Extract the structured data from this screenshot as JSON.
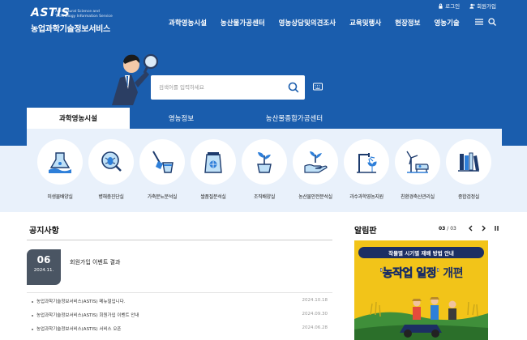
{
  "header": {
    "logo_mark": "ASTIS",
    "logo_sub_1": "Agricultural Science and",
    "logo_sub_2": "Technology Information Service",
    "logo_name": "농업과학기술정보서비스",
    "util": {
      "login": "로그인",
      "join": "회원가입"
    },
    "nav": [
      "과학영농시설",
      "농산물가공센터",
      "영농상담및의견조사",
      "교육및행사",
      "현장정보",
      "영농기술"
    ]
  },
  "search": {
    "placeholder": "검색어를 입력하세요"
  },
  "tabs": [
    {
      "label": "과학영농시설",
      "active": true
    },
    {
      "label": "영농정보",
      "active": false
    },
    {
      "label": "농산물종합가공센터",
      "active": false
    }
  ],
  "facilities": [
    {
      "label": "미생물배양실",
      "icon": "microbe-hand-icon"
    },
    {
      "label": "병해충진단실",
      "icon": "bug-magnifier-icon"
    },
    {
      "label": "가축분뇨분석실",
      "icon": "shovel-bucket-icon"
    },
    {
      "label": "쌀품질분석실",
      "icon": "rice-bag-icon"
    },
    {
      "label": "조직배양실",
      "icon": "sprout-pot-icon"
    },
    {
      "label": "농산물안전분석실",
      "icon": "plant-hand-icon"
    },
    {
      "label": "과수과학영농지원",
      "icon": "sprinkler-plant-icon"
    },
    {
      "label": "친환경축산관리실",
      "icon": "windmill-cow-icon"
    },
    {
      "label": "종합검정실",
      "icon": "book-shelf-icon"
    }
  ],
  "notice": {
    "title": "공지사항",
    "featured": {
      "day": "06",
      "ym": "2024.11.",
      "text": "회원가입 이벤트 결과"
    },
    "items": [
      {
        "text": "농업과학기술정보서비스(ASTIS) 메뉴얼입니다.",
        "date": "2024.10.18"
      },
      {
        "text": "농업과학기술정보서비스(ASTIS) 회원가입 이벤트 안내",
        "date": "2024.09.30"
      },
      {
        "text": "농업과학기술정보서비스(ASTIS) 서비스 오픈",
        "date": "2024.06.28"
      }
    ]
  },
  "alarm": {
    "title": "알림판",
    "current": "03",
    "total": "/ 03",
    "banner_head": "작물별 시기별 재배 방법 안내",
    "banner_main_hl": "'농작업 일정'",
    "banner_main_rest": " 개편"
  },
  "colors": {
    "primary": "#1a5dad",
    "panel": "#e9f1fb",
    "accent": "#2e7fd9",
    "banner": "#f2c419",
    "navy": "#1c2f63"
  }
}
